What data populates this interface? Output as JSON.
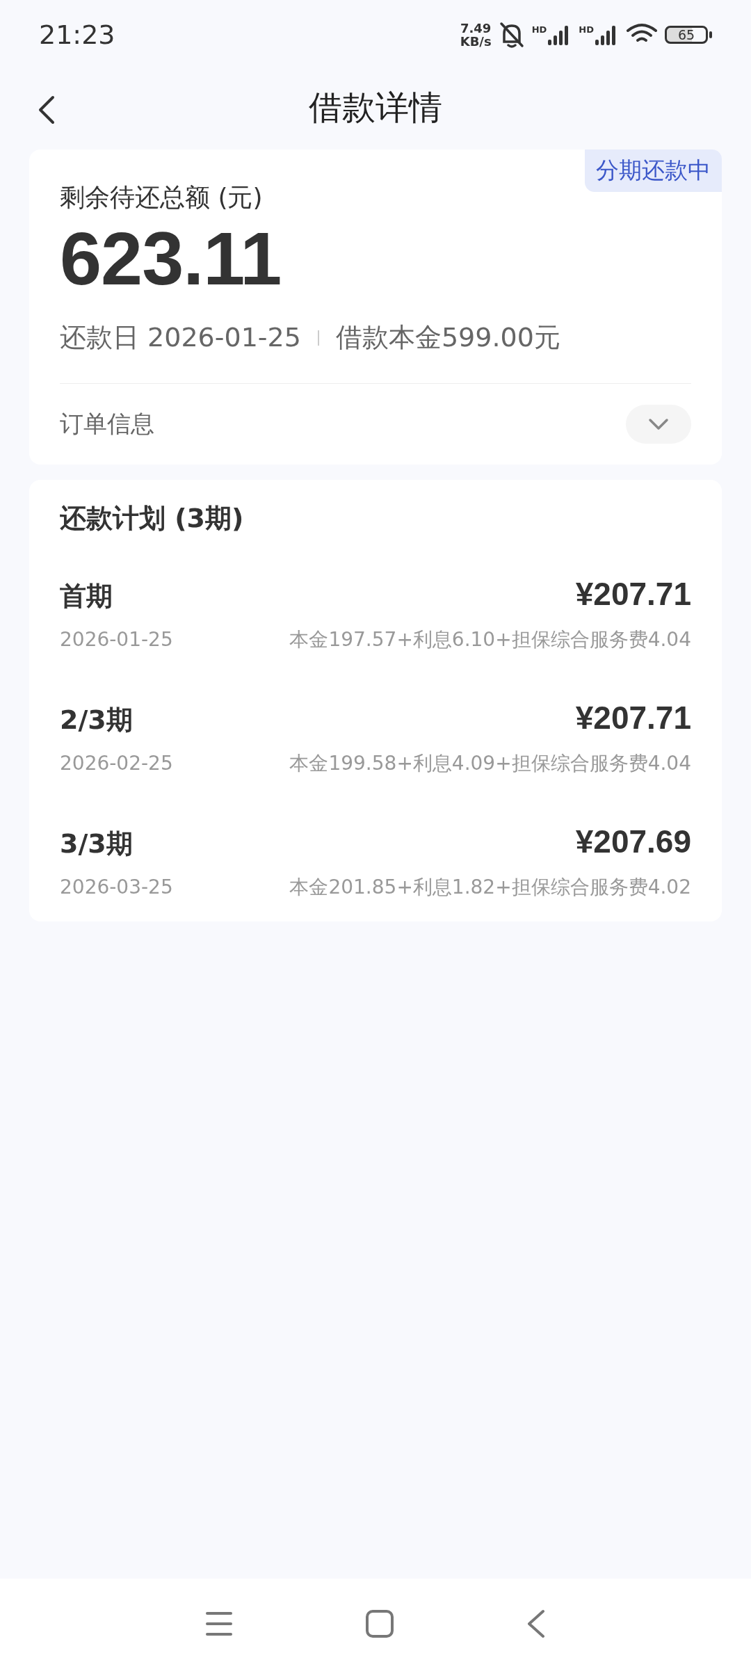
{
  "status_bar": {
    "time": "21:23",
    "speed_value": "7.49",
    "speed_unit": "KB/s",
    "signal_labels": [
      "HD",
      "HD"
    ],
    "battery": "65"
  },
  "header": {
    "title": "借款详情"
  },
  "summary": {
    "badge": "分期还款中",
    "label": "剩余待还总额 (元)",
    "amount": "623.11",
    "due_date": "还款日 2026-01-25",
    "principal": "借款本金599.00元",
    "order_info": "订单信息",
    "order_expanded": false
  },
  "plan": {
    "title": "还款计划 (3期)",
    "rows": [
      {
        "period": "首期",
        "amount": "¥207.71",
        "date": "2026-01-25",
        "breakdown": "本金197.57+利息6.10+担保综合服务费4.04"
      },
      {
        "period": "2/3期",
        "amount": "¥207.71",
        "date": "2026-02-25",
        "breakdown": "本金199.58+利息4.09+担保综合服务费4.04"
      },
      {
        "period": "3/3期",
        "amount": "¥207.69",
        "date": "2026-03-25",
        "breakdown": "本金201.85+利息1.82+担保综合服务费4.02"
      }
    ]
  }
}
